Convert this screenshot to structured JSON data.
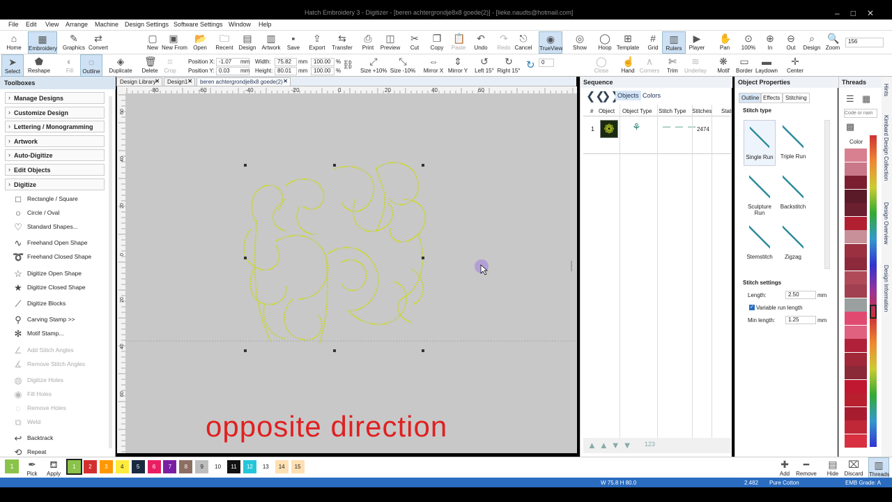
{
  "window": {
    "title": "Hatch Embroidery 3 - Digitizer - [beren achtergrondje8x8 goede(2)] - [lieke.naudts@hotmail.com]"
  },
  "menu": [
    "File",
    "Edit",
    "View",
    "Arrange",
    "Machine",
    "Design Settings",
    "Software Settings",
    "Window",
    "Help"
  ],
  "ribbon1": [
    {
      "label": "Home",
      "icon": "home-icon"
    },
    {
      "label": "Embroidery",
      "icon": "embroidery-icon",
      "active": true
    },
    {
      "label": "Graphics",
      "icon": "pencil-icon"
    },
    {
      "label": "Convert",
      "icon": "convert-icon"
    },
    {
      "label": "New",
      "icon": "new-file-icon"
    },
    {
      "label": "New From",
      "icon": "new-from-icon"
    },
    {
      "label": "Open",
      "icon": "folder-open-icon"
    },
    {
      "label": "Recent",
      "icon": "recent-icon"
    },
    {
      "label": "Design",
      "icon": "design-icon"
    },
    {
      "label": "Artwork",
      "icon": "artwork-icon"
    },
    {
      "label": "Save",
      "icon": "save-icon"
    },
    {
      "label": "Export",
      "icon": "export-icon"
    },
    {
      "label": "Transfer",
      "icon": "transfer-icon"
    },
    {
      "label": "Print",
      "icon": "print-icon"
    },
    {
      "label": "Preview",
      "icon": "preview-icon"
    },
    {
      "label": "Cut",
      "icon": "cut-icon"
    },
    {
      "label": "Copy",
      "icon": "copy-icon"
    },
    {
      "label": "Paste",
      "icon": "paste-icon",
      "disabled": true
    },
    {
      "label": "Undo",
      "icon": "undo-icon"
    },
    {
      "label": "Redo",
      "icon": "redo-icon",
      "disabled": true
    },
    {
      "label": "Cancel",
      "icon": "cancel-icon"
    },
    {
      "label": "TrueView",
      "icon": "trueview-icon",
      "active": true
    },
    {
      "label": "Show",
      "icon": "show-icon"
    },
    {
      "label": "Hoop",
      "icon": "hoop-icon"
    },
    {
      "label": "Template",
      "icon": "template-icon"
    },
    {
      "label": "Grid",
      "icon": "grid-icon"
    },
    {
      "label": "Rulers",
      "icon": "rulers-icon",
      "active": true
    },
    {
      "label": "Player",
      "icon": "player-icon"
    },
    {
      "label": "Pan",
      "icon": "pan-icon"
    },
    {
      "label": "100%",
      "icon": "zoom-100-icon"
    },
    {
      "label": "In",
      "icon": "zoom-in-icon"
    },
    {
      "label": "Out",
      "icon": "zoom-out-icon"
    },
    {
      "label": "Design",
      "icon": "zoom-design-icon"
    },
    {
      "label": "Zoom",
      "icon": "zoom-icon"
    }
  ],
  "zoom_value": "156",
  "ribbon2": [
    {
      "label": "Select",
      "icon": "select-arrow-icon",
      "active": true
    },
    {
      "label": "Reshape",
      "icon": "reshape-icon"
    },
    {
      "label": "Fill",
      "icon": "fill-icon",
      "disabled": true
    },
    {
      "label": "Outline",
      "icon": "outline-icon",
      "active": true
    },
    {
      "label": "Duplicate",
      "icon": "duplicate-icon"
    },
    {
      "label": "Delete",
      "icon": "delete-icon"
    },
    {
      "label": "Crop",
      "icon": "crop-icon",
      "disabled": true
    }
  ],
  "position": {
    "x_label": "Position X:",
    "x": "-1.07",
    "y_label": "Position Y:",
    "y": "0.03",
    "unit": "mm"
  },
  "size": {
    "w_label": "Width:",
    "w": "75.82",
    "h_label": "Height:",
    "h": "80.01",
    "unit": "mm",
    "pw": "100.00",
    "ph": "100.00",
    "pct": "%"
  },
  "ribbon2b": [
    {
      "label": "Size +10%",
      "icon": "size-plus-icon"
    },
    {
      "label": "Size -10%",
      "icon": "size-minus-icon"
    },
    {
      "label": "Mirror X",
      "icon": "mirror-x-icon"
    },
    {
      "label": "Mirror Y",
      "icon": "mirror-y-icon"
    },
    {
      "label": "Left 15°",
      "icon": "rotate-left-icon"
    },
    {
      "label": "Right 15°",
      "icon": "rotate-right-icon"
    }
  ],
  "rotate_value": "0",
  "ribbon2c": [
    {
      "label": "Close",
      "icon": "close-shape-icon",
      "disabled": true
    },
    {
      "label": "Hand",
      "icon": "hand-icon"
    },
    {
      "label": "Corners",
      "icon": "corners-icon",
      "disabled": true
    },
    {
      "label": "Trim",
      "icon": "trim-icon"
    },
    {
      "label": "Underlay",
      "icon": "underlay-icon",
      "disabled": true
    },
    {
      "label": "Motif",
      "icon": "motif-icon"
    },
    {
      "label": "Border",
      "icon": "border-icon"
    },
    {
      "label": "Laydown",
      "icon": "laydown-icon"
    },
    {
      "label": "Center",
      "icon": "center-icon"
    }
  ],
  "toolbox": {
    "title": "Toolboxes",
    "categories": [
      "Manage Designs",
      "Customize Design",
      "Lettering / Monogramming",
      "Artwork",
      "Auto-Digitize",
      "Edit Objects",
      "Digitize"
    ],
    "items": [
      {
        "label": "Rectangle / Square",
        "icon": "rectangle-icon"
      },
      {
        "label": "Circle / Oval",
        "icon": "circle-icon"
      },
      {
        "label": "Standard Shapes...",
        "icon": "shapes-icon"
      },
      {
        "label": "Freehand Open Shape",
        "icon": "freehand-open-icon"
      },
      {
        "label": "Freehand Closed Shape",
        "icon": "freehand-closed-icon"
      },
      {
        "label": "Digitize Open Shape",
        "icon": "star-open-icon"
      },
      {
        "label": "Digitize Closed Shape",
        "icon": "star-closed-icon"
      },
      {
        "label": "Digitize Blocks",
        "icon": "blocks-icon"
      },
      {
        "label": "Carving Stamp >>",
        "icon": "stamp-icon"
      },
      {
        "label": "Motif Stamp...",
        "icon": "motif-stamp-icon"
      },
      {
        "label": "Add Stitch Angles",
        "icon": "add-angles-icon",
        "disabled": true
      },
      {
        "label": "Remove Stitch Angles",
        "icon": "remove-angles-icon",
        "disabled": true
      },
      {
        "label": "Digitize Holes",
        "icon": "holes-icon",
        "disabled": true
      },
      {
        "label": "Fill Holes",
        "icon": "fill-holes-icon",
        "disabled": true
      },
      {
        "label": "Remove Holes",
        "icon": "remove-holes-icon",
        "disabled": true
      },
      {
        "label": "Weld",
        "icon": "weld-icon",
        "disabled": true
      },
      {
        "label": "Backtrack",
        "icon": "backtrack-icon"
      },
      {
        "label": "Repeat",
        "icon": "repeat-icon"
      }
    ]
  },
  "doc_tabs": [
    "Design Library",
    "Design1",
    "beren achtergrondje8x8 goede(2)"
  ],
  "ruler_top": [
    "-80",
    "-60",
    "-40",
    "-20",
    "0",
    "20",
    "40",
    "60"
  ],
  "ruler_left": [
    "60",
    "40",
    "20",
    "0",
    "20",
    "40",
    "60"
  ],
  "caption": "opposite direction",
  "sequence": {
    "title": "Sequence",
    "tab_objects": "Objects",
    "tab_colors": "Colors",
    "headers": [
      "#",
      "Object",
      "Object Type",
      "Stitch Type",
      "Stitches",
      "Status"
    ],
    "rows": [
      {
        "num": "1",
        "stitches": "2474"
      }
    ],
    "footer_label": "123"
  },
  "properties": {
    "title": "Object Properties",
    "tabs": [
      "Outline",
      "Effects",
      "Stitching"
    ],
    "stitch_type_label": "Stitch type",
    "types": [
      "Single Run",
      "Triple Run",
      "Sculpture Run",
      "Backstitch",
      "Stemstitch",
      "Zigzag"
    ],
    "settings_label": "Stitch settings",
    "length_label": "Length:",
    "length": "2.50",
    "unit": "mm",
    "variable_label": "Variable run length",
    "minlen_label": "Min length:",
    "minlen": "1.25"
  },
  "threads": {
    "title": "Threads",
    "search_placeholder": "Code or nam",
    "color_label": "Color",
    "colors": [
      "#d88090",
      "#c9788a",
      "#7a1e30",
      "#5a1a28",
      "#6b2030",
      "#b02030",
      "#c89098",
      "#9a3040",
      "#8c2a3c",
      "#b04a58",
      "#a04050",
      "#9aa0a0",
      "#e04a70",
      "#e06080",
      "#b02038",
      "#a02838",
      "#8a2a38",
      "#c01830",
      "#b82030",
      "#a81c30",
      "#c02838",
      "#d83040"
    ]
  },
  "vtabs": [
    "Hints",
    "Kimbard Design Collection",
    "Design Overview",
    "Design Information"
  ],
  "bottom": {
    "pick": "Pick",
    "apply": "Apply",
    "swatches": [
      {
        "n": "1",
        "c": "#8bc34a"
      },
      {
        "n": "2",
        "c": "#d32f2f"
      },
      {
        "n": "3",
        "c": "#ff9800"
      },
      {
        "n": "4",
        "c": "#ffeb3b"
      },
      {
        "n": "5",
        "c": "#1a2a40"
      },
      {
        "n": "6",
        "c": "#e91e63"
      },
      {
        "n": "7",
        "c": "#7b1fa2"
      },
      {
        "n": "8",
        "c": "#8d6e63"
      },
      {
        "n": "9",
        "c": "#bdbdbd"
      },
      {
        "n": "10",
        "c": "#ffffff"
      },
      {
        "n": "11",
        "c": "#111111"
      },
      {
        "n": "12",
        "c": "#26c6da"
      },
      {
        "n": "13",
        "c": "#ffffff"
      },
      {
        "n": "14",
        "c": "#ffe0b2"
      },
      {
        "n": "15",
        "c": "#ffe0b2"
      }
    ],
    "add": "Add",
    "remove": "Remove",
    "hide": "Hide",
    "discard": "Discard",
    "threads": "Threads"
  },
  "status": {
    "dims": "W 75.8 H 80.0",
    "val": "2.482",
    "thread": "Pure Cotton",
    "grade": "EMB Grade: A"
  },
  "colors": {
    "accent": "#2a6cc0",
    "stitch": "#c8d62a",
    "caption": "#e02020"
  }
}
